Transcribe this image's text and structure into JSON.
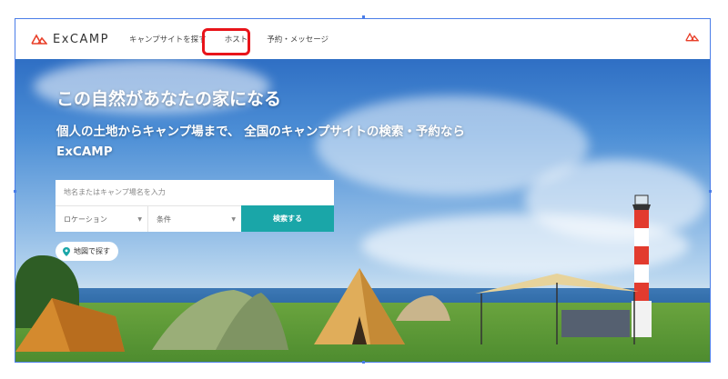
{
  "header": {
    "logo_text": "ExCAMP",
    "nav": [
      "キャンプサイトを探す",
      "ホスト",
      "予約・メッセージ"
    ]
  },
  "hero": {
    "title": "この自然があなたの家になる",
    "subtitle": "個人の土地からキャンプ場まで、 全国のキャンプサイトの検索・予約ならExCAMP"
  },
  "search": {
    "placeholder": "地名またはキャンプ場名を入力",
    "location_label": "ロケーション",
    "condition_label": "条件",
    "button_label": "検索する"
  },
  "map_button": {
    "label": "地図で探す"
  },
  "colors": {
    "accent": "#1aa6a8",
    "logo": "#e8402a",
    "highlight": "#e8141a"
  },
  "icons": {
    "logo": "mountain-logo-icon",
    "map": "map-pin-icon",
    "caret": "chevron-down-icon"
  }
}
